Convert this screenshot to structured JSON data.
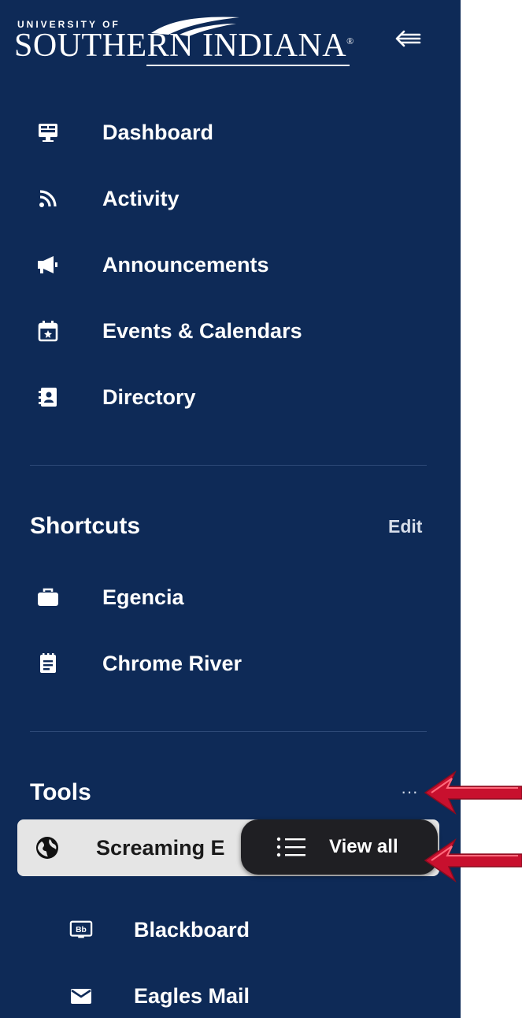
{
  "logo": {
    "top_text": "UNIVERSITY OF",
    "main_text": "SOUTHERN INDIANA",
    "mark": "®"
  },
  "header": {
    "collapse_icon": "collapse-left-icon"
  },
  "nav": {
    "items": [
      {
        "label": "Dashboard",
        "icon": "monitor-icon"
      },
      {
        "label": "Activity",
        "icon": "rss-icon"
      },
      {
        "label": "Announcements",
        "icon": "megaphone-icon"
      },
      {
        "label": "Events & Calendars",
        "icon": "calendar-star-icon"
      },
      {
        "label": "Directory",
        "icon": "contact-book-icon"
      }
    ]
  },
  "shortcuts": {
    "title": "Shortcuts",
    "edit_label": "Edit",
    "items": [
      {
        "label": "Egencia",
        "icon": "briefcase-icon"
      },
      {
        "label": "Chrome River",
        "icon": "receipt-icon"
      }
    ]
  },
  "tools": {
    "title": "Tools",
    "more_label": "···",
    "selected": {
      "label": "Screaming E",
      "icon": "globe-icon"
    },
    "items": [
      {
        "label": "Blackboard",
        "icon": "blackboard-icon",
        "badge": "Bb"
      },
      {
        "label": "Eagles Mail",
        "icon": "mail-icon"
      }
    ]
  },
  "popover": {
    "label": "View all",
    "icon": "list-icon"
  },
  "colors": {
    "sidebar_bg": "#0e2a57",
    "arrow_red": "#c8102e",
    "popover_bg": "#1f1f23"
  }
}
